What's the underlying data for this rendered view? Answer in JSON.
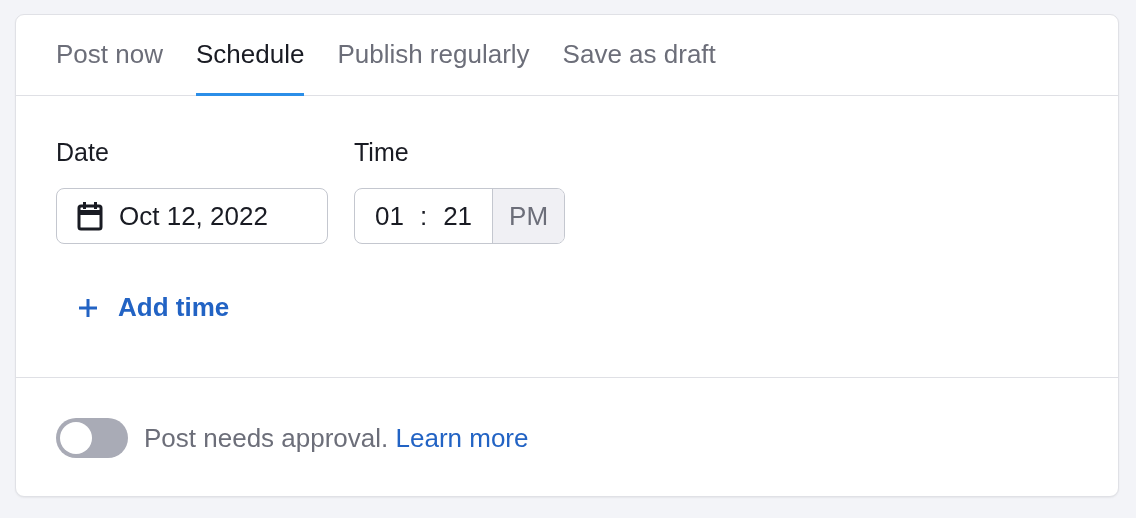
{
  "tabs": [
    {
      "label": "Post now",
      "selected": false
    },
    {
      "label": "Schedule",
      "selected": true
    },
    {
      "label": "Publish regularly",
      "selected": false
    },
    {
      "label": "Save as draft",
      "selected": false
    }
  ],
  "date": {
    "label": "Date",
    "value": "Oct 12, 2022"
  },
  "time": {
    "label": "Time",
    "hour": "01",
    "separator": ":",
    "minute": "21",
    "period": "PM"
  },
  "add_time": {
    "label": "Add time"
  },
  "approval": {
    "on": false,
    "text": "Post needs approval.",
    "link": "Learn more"
  }
}
